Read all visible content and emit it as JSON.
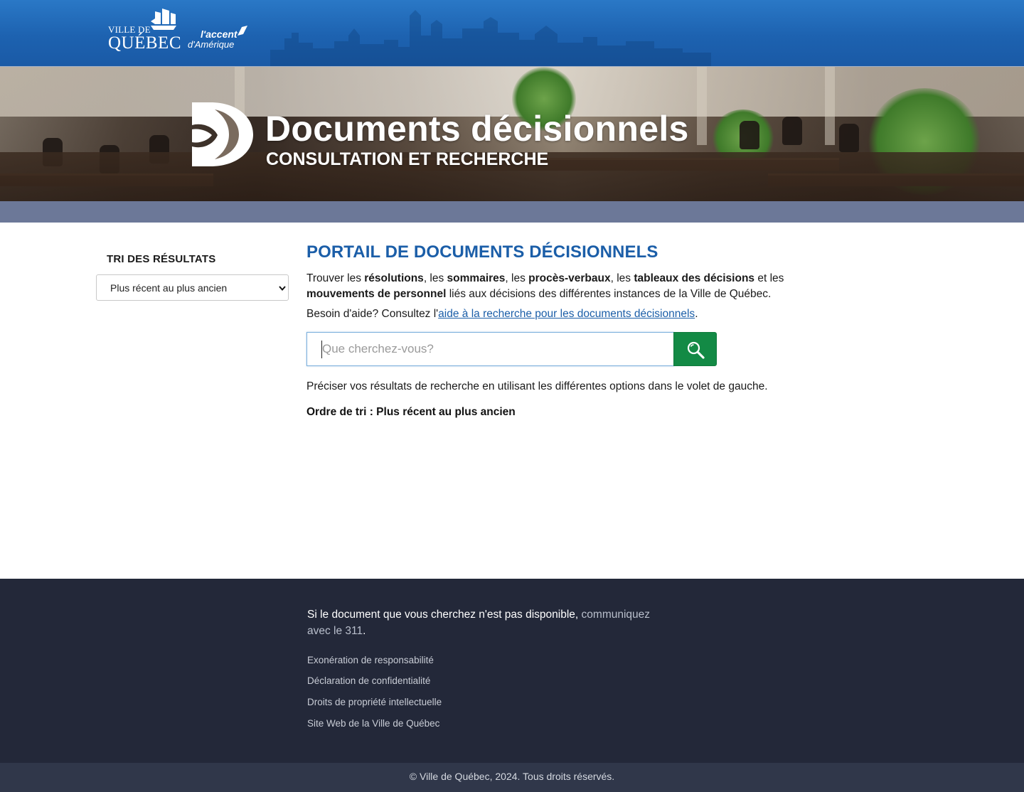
{
  "header": {
    "logo_city_small": "VILLE DE",
    "logo_city_big": "QUÉBEC",
    "logo_accent_line1": "l'accent",
    "logo_accent_line2": "d'Amérique"
  },
  "hero": {
    "title": "Documents décisionnels",
    "subtitle": "CONSULTATION ET RECHERCHE"
  },
  "sidebar": {
    "title": "TRI DES RÉSULTATS",
    "sort_selected": "Plus récent au plus ancien"
  },
  "main": {
    "title": "PORTAIL DE DOCUMENTS DÉCISIONNELS",
    "intro": {
      "p1": "Trouver les ",
      "b1": "résolutions",
      "p2": ", les ",
      "b2": "sommaires",
      "p3": ", les ",
      "b3": "procès-verbaux",
      "p4": ", les ",
      "b4": "tableaux des décisions",
      "p5": " et les ",
      "b5": "mouvements de personnel",
      "p6": " liés aux décisions des différentes instances de la Ville de Québec."
    },
    "help_prefix": "Besoin d'aide? Consultez l'",
    "help_link": "aide à la recherche pour les documents décisionnels",
    "help_suffix": ".",
    "search_placeholder": "Que cherchez-vous?",
    "refine_text": "Préciser vos résultats de recherche en utilisant les différentes options dans le volet de gauche.",
    "order_text": "Ordre de tri : Plus récent au plus ancien"
  },
  "footer": {
    "message_prefix": "Si le document que vous cherchez n'est pas disponible, ",
    "message_link": "communiquez avec le 311",
    "message_suffix": ".",
    "links": [
      "Exonération de responsabilité",
      "Déclaration de confidentialité",
      "Droits de propriété intellectuelle",
      "Site Web de la Ville de Québec"
    ],
    "copyright": "© Ville de Québec, 2024. Tous droits réservés."
  },
  "colors": {
    "header_blue": "#1d62b0",
    "title_blue": "#1b5ea8",
    "search_green": "#138a45",
    "stripe": "#6c7898",
    "footer_bg": "#232839"
  },
  "icons": [
    "ship-icon",
    "accent-flag-icon",
    "documents-logo-icon",
    "chevron-down-icon",
    "search-icon"
  ]
}
